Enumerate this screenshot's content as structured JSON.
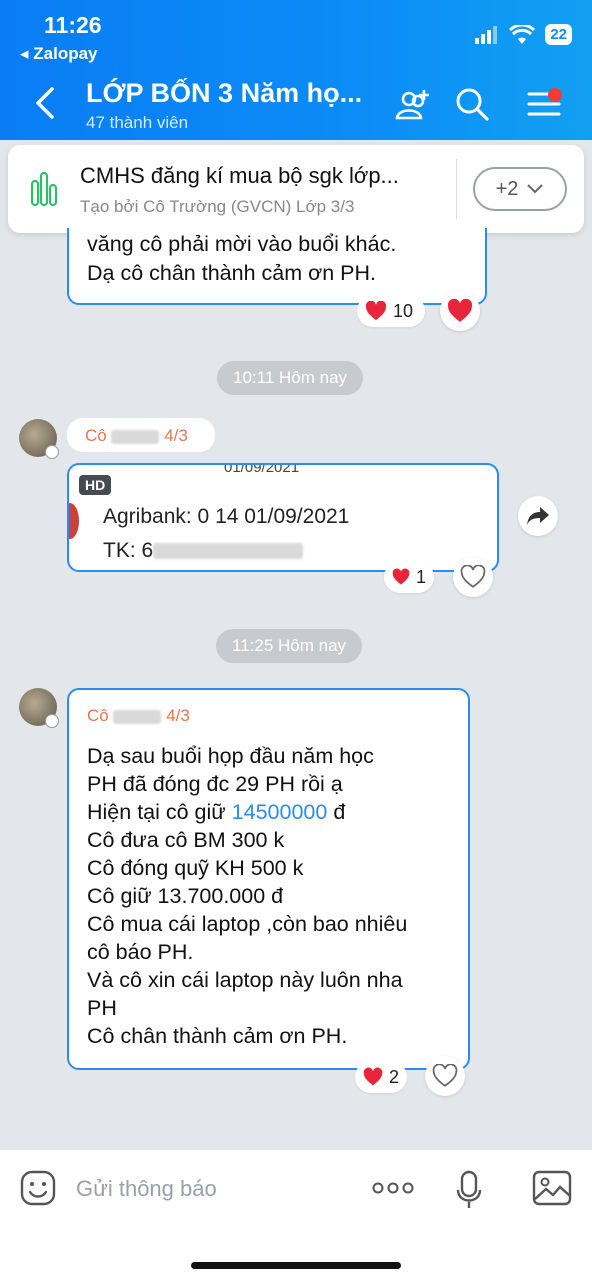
{
  "status_bar": {
    "time": "11:26",
    "back_app": "Zalopay",
    "battery": "22"
  },
  "header": {
    "title": "LỚP BỐN 3 Năm họ...",
    "subtitle": "47 thành viên"
  },
  "pinned": {
    "title": "CMHS đăng kí mua bộ sgk lớp...",
    "subtitle": "Tạo bởi Cô Trường (GVCN) Lớp 3/3",
    "more_label": "+2"
  },
  "messages": {
    "first": {
      "line1": "văng cô phải mời vào buổi khác.",
      "line2": "Dạ cô chân thành cảm ơn PH.",
      "reaction_count": "10"
    },
    "sep1": "10:11 Hôm nay",
    "second": {
      "sender_prefix": "Cô",
      "sender_suffix": "4/3",
      "hd_badge": "HD",
      "image_top": "01/09/2021",
      "line1": "Agribank: 0 14 01/09/2021",
      "line2_prefix": "TK: 6",
      "reaction_count": "1"
    },
    "sep2": "11:25 Hôm nay",
    "third": {
      "sender_prefix": "Cô",
      "sender_suffix": "4/3",
      "lines": [
        "Dạ sau buổi họp đầu năm học",
        "PH đã đóng đc 29 PH rồi ạ",
        "Hiện tại cô giữ",
        "Cô đưa cô BM 300 k",
        "Cô đóng quỹ KH 500 k",
        "Cô giữ 13.700.000 đ",
        "Cô mua cái laptop ,còn bao nhiêu",
        "cô báo PH.",
        "Và cô xin cái laptop này luôn nha",
        "PH",
        "Cô chân thành cảm ơn PH."
      ],
      "amount_link": "14500000",
      "amount_unit": "đ",
      "reaction_count": "2"
    }
  },
  "input": {
    "placeholder": "Gửi thông báo"
  },
  "colors": {
    "header": "#0b8cf6",
    "bubble_border": "#2a8cf0",
    "sender": "#e0794f",
    "link": "#2a8cf0",
    "heart": "#e8263b"
  }
}
